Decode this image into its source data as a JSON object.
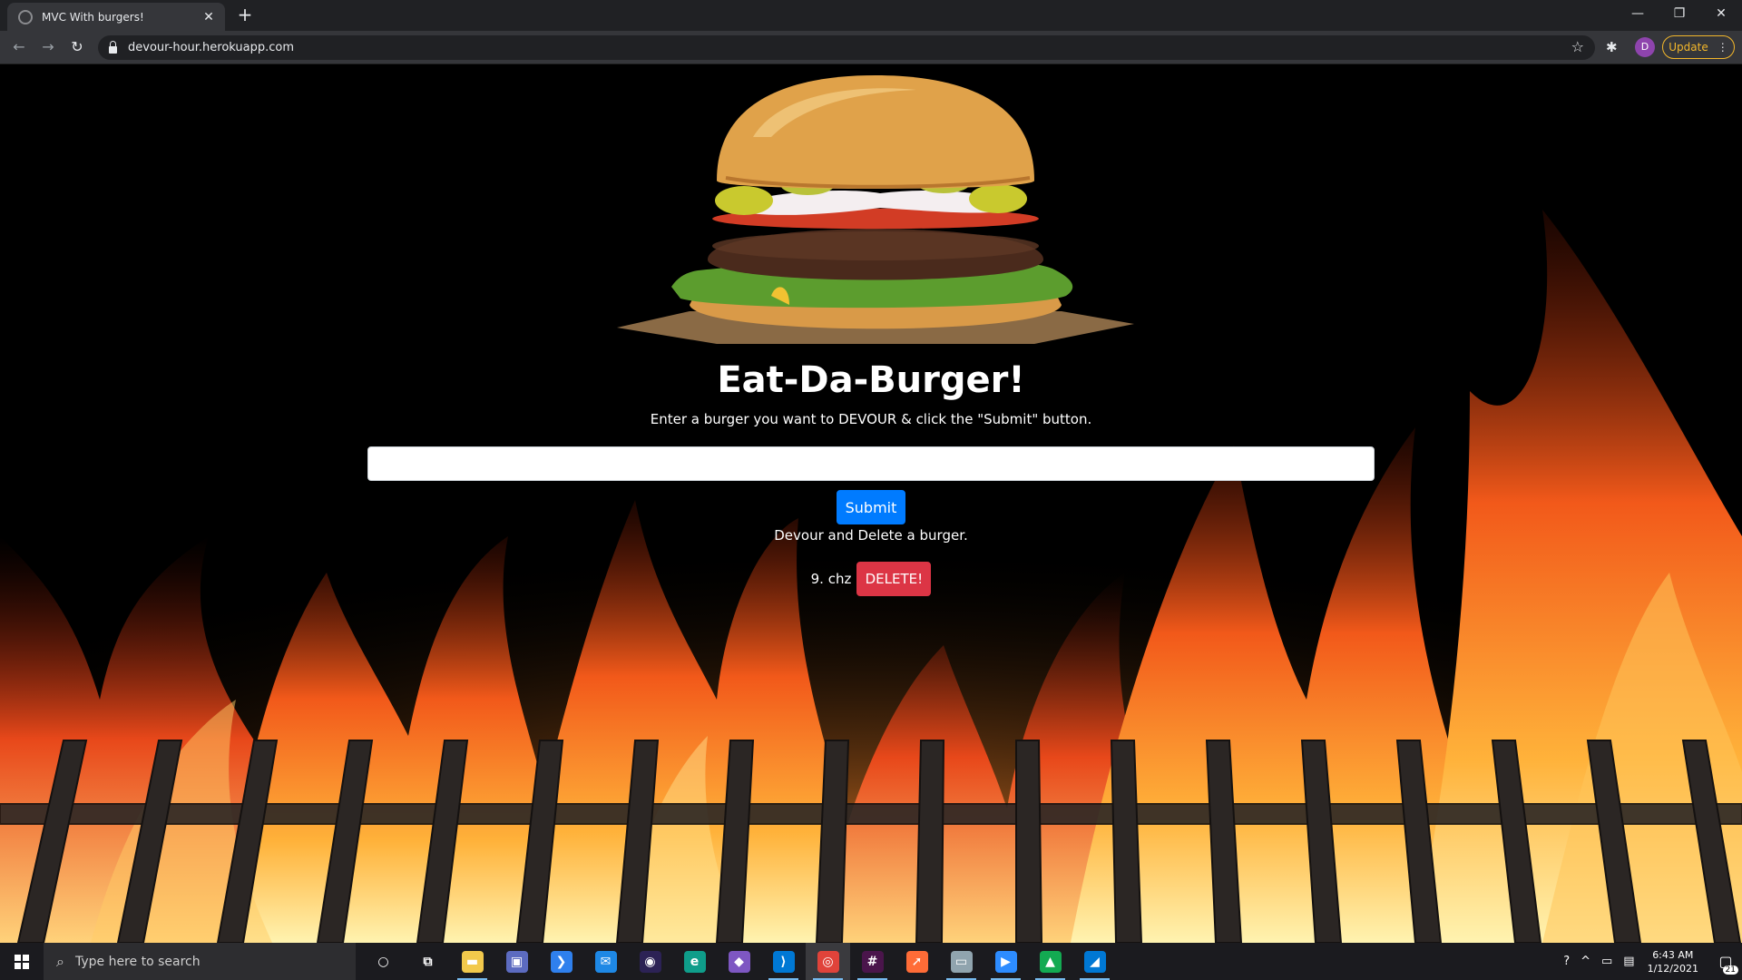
{
  "browser": {
    "tab_title": "MVC With burgers!",
    "tab_close": "✕",
    "new_tab": "+",
    "url": "devour-hour.herokuapp.com",
    "profile_initial": "D",
    "update_label": "Update",
    "menu_dots": "⋮",
    "window": {
      "minimize": "—",
      "restore": "❐",
      "close": "✕"
    },
    "nav": {
      "back": "←",
      "forward": "→",
      "reload": "↻"
    },
    "star": "☆",
    "extensions": "✱"
  },
  "page": {
    "title": "Eat-Da-Burger!",
    "subtitle": "Enter a burger you want to DEVOUR & click the \"Submit\" button.",
    "input_value": "",
    "submit_label": "Submit",
    "devour_heading": "Devour and Delete a burger.",
    "burgers": [
      {
        "label": "9. chz",
        "button": "DELETE!"
      }
    ]
  },
  "taskbar": {
    "search_placeholder": "Type here to search",
    "icons": [
      {
        "name": "cortana-icon",
        "glyph": "○",
        "color": "transparent"
      },
      {
        "name": "task-view-icon",
        "glyph": "⧉",
        "color": "transparent"
      },
      {
        "name": "file-explorer-icon",
        "glyph": "▬",
        "color": "#f2c94c"
      },
      {
        "name": "store-icon",
        "glyph": "▣",
        "color": "#5c6bc0"
      },
      {
        "name": "vs-icon",
        "glyph": "❯",
        "color": "#2f80ed"
      },
      {
        "name": "mail-icon",
        "glyph": "✉",
        "color": "#1e88e5"
      },
      {
        "name": "eclipse-icon",
        "glyph": "◉",
        "color": "#2c2255"
      },
      {
        "name": "edge-icon",
        "glyph": "e",
        "color": "#0f9d8a"
      },
      {
        "name": "git-icon",
        "glyph": "◆",
        "color": "#7e57c2"
      },
      {
        "name": "vscode-icon",
        "glyph": "⟩",
        "color": "#0078d4"
      },
      {
        "name": "chrome-icon",
        "glyph": "◎",
        "color": "#e0433a"
      },
      {
        "name": "slack-icon",
        "glyph": "#",
        "color": "#4a154b"
      },
      {
        "name": "postman-icon",
        "glyph": "➚",
        "color": "#ff6c37"
      },
      {
        "name": "remote-desktop-icon",
        "glyph": "▭",
        "color": "#90a4ae"
      },
      {
        "name": "zoom-icon",
        "glyph": "▶",
        "color": "#2d8cff"
      },
      {
        "name": "mongodb-icon",
        "glyph": "▲",
        "color": "#13aa52"
      },
      {
        "name": "photos-icon",
        "glyph": "◢",
        "color": "#0078d4"
      }
    ],
    "time": "6:43 AM",
    "date": "1/12/2021",
    "notification_count": "21"
  }
}
